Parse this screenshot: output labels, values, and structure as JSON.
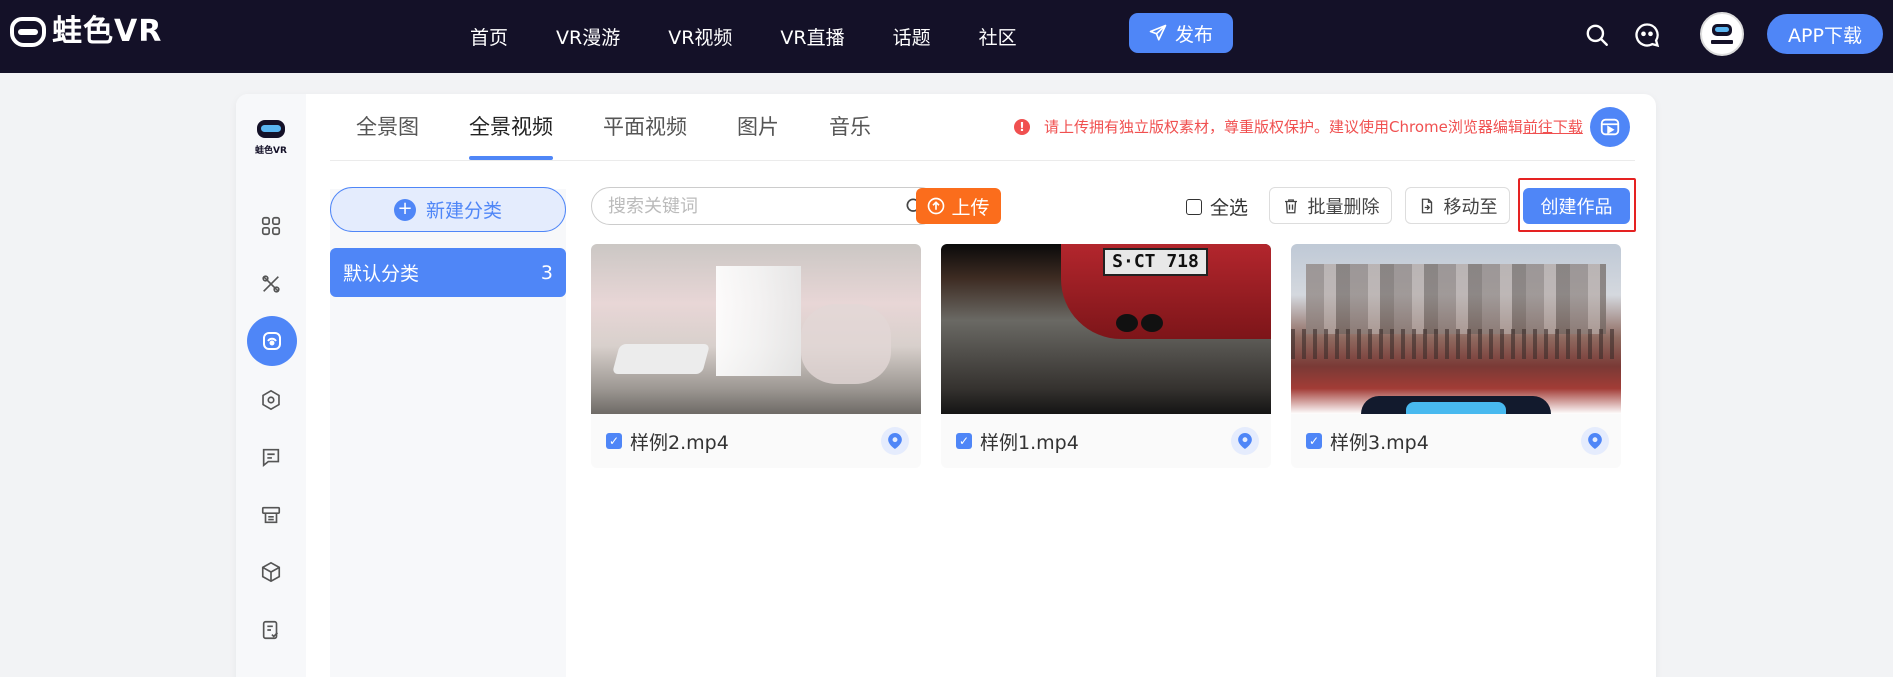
{
  "topnav": {
    "logo_text": "蛙色VR",
    "links": [
      "首页",
      "VR漫游",
      "VR视频",
      "VR直播",
      "话题",
      "社区"
    ],
    "publish_label": "发布",
    "app_download_label": "APP下载",
    "avatar_text": "蛙色VR"
  },
  "sidebar": {
    "logo_text": "蛙色VR",
    "icons": [
      "dashboard-icon",
      "tools-icon",
      "media-library-icon",
      "settings-icon",
      "message-icon",
      "printer-icon",
      "cube-icon",
      "document-check-icon"
    ],
    "active_icon": "media-library-icon"
  },
  "tabs": {
    "items": [
      "全景图",
      "全景视频",
      "平面视频",
      "图片",
      "音乐"
    ],
    "active": "全景视频"
  },
  "notice": {
    "text": "请上传拥有独立版权素材，尊重版权保护。建议使用Chrome浏览器编辑",
    "link": "前往下载"
  },
  "categories": {
    "new_label": "新建分类",
    "items": [
      {
        "name": "默认分类",
        "count": "3"
      }
    ]
  },
  "toolbar": {
    "search_placeholder": "搜索关键词",
    "upload_label": "上传",
    "select_all_label": "全选",
    "batch_delete_label": "批量删除",
    "move_to_label": "移动至",
    "create_label": "创建作品"
  },
  "media": {
    "items": [
      {
        "name": "样例2.mp4",
        "checked": true
      },
      {
        "name": "样例1.mp4",
        "checked": true,
        "plate_text": "S·CT 718"
      },
      {
        "name": "样例3.mp4",
        "checked": true
      }
    ]
  },
  "colors": {
    "accent": "#4f86f7",
    "nav_bg": "#141128",
    "upload": "#fb6d1c",
    "notice": "#f05050",
    "highlight": "#e52222"
  }
}
